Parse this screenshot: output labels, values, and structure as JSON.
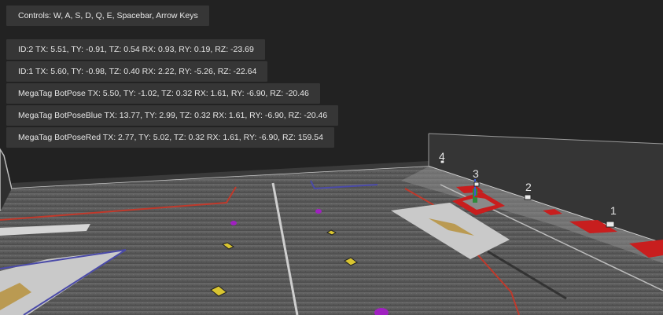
{
  "controls": {
    "text": "Controls: W, A, S, D, Q, E, Spacebar, Arrow Keys"
  },
  "stats": [
    {
      "text": "ID:2 TX: 5.51, TY: -0.91, TZ: 0.54 RX: 0.93, RY: 0.19, RZ: -23.69"
    },
    {
      "text": "ID:1 TX: 5.60, TY: -0.98, TZ: 0.40 RX: 2.22, RY: -5.26, RZ: -22.64"
    },
    {
      "text": "MegaTag BotPose TX: 5.50, TY: -1.02, TZ: 0.32 RX: 1.61, RY: -6.90, RZ: -20.46"
    },
    {
      "text": "MegaTag BotPoseBlue TX: 13.77, TY: 2.99, TZ: 0.32 RX: 1.61, RY: -6.90, RZ: -20.46"
    },
    {
      "text": "MegaTag BotPoseRed TX: 2.77, TY: 5.02, TZ: 0.32 RX: 1.61, RY: -6.90, RZ: 159.54"
    }
  ],
  "tag_labels": [
    "4",
    "3",
    "2",
    "1"
  ],
  "colors": {
    "background": "#222222",
    "panel": "#363636",
    "panel_text": "#e6e6e6",
    "field_carpet": "#5a5a5a",
    "red_line": "#c0392b",
    "blue_line": "#4a4aa8",
    "wall": "#3a3a3a",
    "robot": "#c81e1e"
  }
}
